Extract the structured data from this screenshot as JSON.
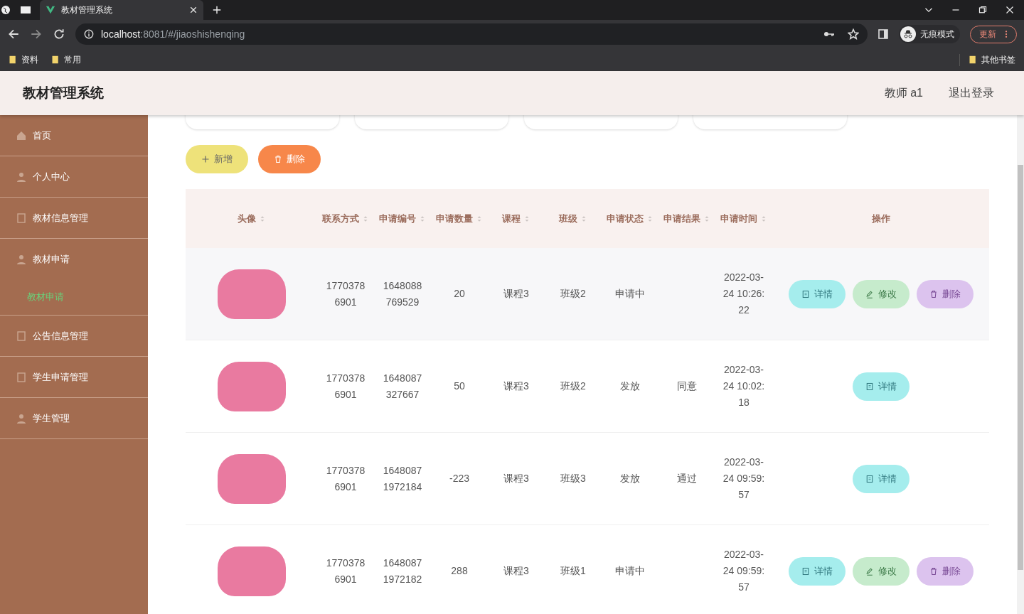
{
  "browser": {
    "tabs": [
      {
        "title": "教材管理系统",
        "selected": true
      }
    ],
    "url_host": "localhost",
    "url_path": ":8081/#/jiaoshishenqing",
    "profile_label": "无痕模式",
    "update_button": "更新",
    "bookmarks": [
      "资料",
      "常用"
    ],
    "other_bookmarks": "其他书签"
  },
  "app": {
    "title": "教材管理系统",
    "user": "教师 a1",
    "logout": "退出登录"
  },
  "sidebar": {
    "items": [
      {
        "label": "首页"
      },
      {
        "label": "个人中心"
      },
      {
        "label": "教材信息管理"
      },
      {
        "label": "教材申请",
        "children": [
          {
            "label": "教材申请",
            "selected": true
          }
        ]
      },
      {
        "label": "公告信息管理"
      },
      {
        "label": "学生申请管理"
      },
      {
        "label": "学生管理"
      }
    ]
  },
  "toolbar": {
    "buttons": [
      {
        "label": "新增",
        "kind": "add"
      },
      {
        "label": "删除",
        "kind": "delete"
      }
    ]
  },
  "table": {
    "columns": [
      {
        "label": "头像",
        "sortable": true
      },
      {
        "label": "联系方式",
        "sortable": true
      },
      {
        "label": "申请编号",
        "sortable": true
      },
      {
        "label": "申请数量",
        "sortable": true
      },
      {
        "label": "课程",
        "sortable": true
      },
      {
        "label": "班级",
        "sortable": true
      },
      {
        "label": "申请状态",
        "sortable": true
      },
      {
        "label": "申请结果",
        "sortable": true
      },
      {
        "label": "申请时间",
        "sortable": true
      },
      {
        "label": "操作",
        "sortable": false
      }
    ],
    "rows": [
      {
        "phone": "17703786901",
        "number": "1648088769529",
        "quantity": "20",
        "course": "课程3",
        "class": "班级2",
        "status": "申请中",
        "time": "2022-03-24 10:26:22",
        "actions": [
          {
            "label": "详情",
            "kind": "detail"
          },
          {
            "label": "修改",
            "kind": "edit"
          },
          {
            "label": "删除",
            "kind": "delete"
          }
        ]
      },
      {
        "phone": "17703786901",
        "number": "1648087327667",
        "quantity": "50",
        "course": "课程3",
        "class": "班级2",
        "status": "发放",
        "result": "同意",
        "time": "2022-03-24 10:02:18",
        "actions": [
          {
            "label": "详情",
            "kind": "detail"
          }
        ]
      },
      {
        "phone": "17703786901",
        "number": "16480871972184",
        "quantity": "-223",
        "course": "课程3",
        "class": "班级3",
        "status": "发放",
        "result": "通过",
        "time": "2022-03-24 09:59:57",
        "actions": [
          {
            "label": "详情",
            "kind": "detail"
          }
        ]
      },
      {
        "phone": "17703786901",
        "number": "16480871972182",
        "quantity": "288",
        "course": "课程3",
        "class": "班级1",
        "status": "申请中",
        "time": "2022-03-24 09:59:57",
        "actions": [
          {
            "label": "详情",
            "kind": "detail"
          },
          {
            "label": "修改",
            "kind": "edit"
          },
          {
            "label": "删除",
            "kind": "delete"
          }
        ]
      }
    ]
  }
}
